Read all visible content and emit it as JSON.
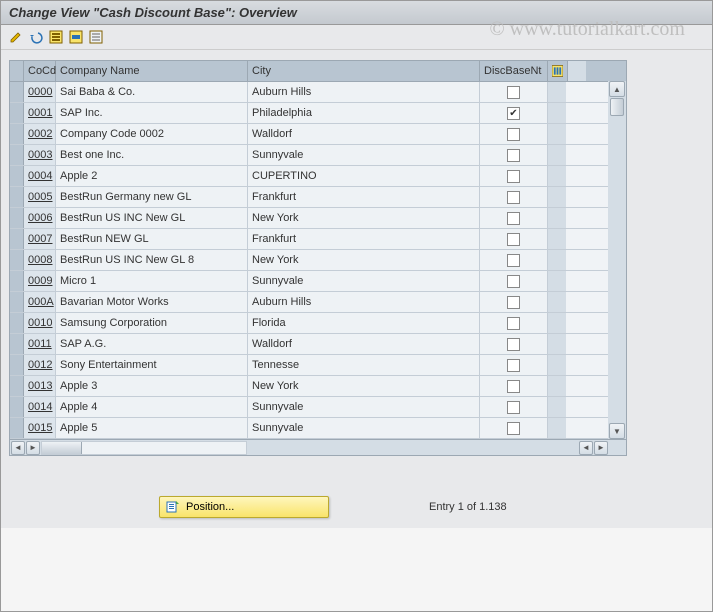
{
  "title": "Change View \"Cash Discount Base\": Overview",
  "watermark": "© www.tutorialkart.com",
  "toolbar": {
    "icons": [
      "edit-icon",
      "undo-icon",
      "select-all-icon",
      "select-block-icon",
      "deselect-icon"
    ]
  },
  "table": {
    "headers": {
      "cocd": "CoCd",
      "name": "Company Name",
      "city": "City",
      "disc": "DiscBaseNt"
    },
    "rows": [
      {
        "cocd": "0000",
        "name": "Sai Baba & Co.",
        "city": "Auburn Hills",
        "disc": false
      },
      {
        "cocd": "0001",
        "name": "SAP Inc.",
        "city": "Philadelphia",
        "disc": true
      },
      {
        "cocd": "0002",
        "name": "Company Code 0002",
        "city": "Walldorf",
        "disc": false
      },
      {
        "cocd": "0003",
        "name": "Best one Inc.",
        "city": "Sunnyvale",
        "disc": false
      },
      {
        "cocd": "0004",
        "name": "Apple 2",
        "city": "CUPERTINO",
        "disc": false
      },
      {
        "cocd": "0005",
        "name": "BestRun Germany new GL",
        "city": "Frankfurt",
        "disc": false
      },
      {
        "cocd": "0006",
        "name": "BestRun US INC New GL",
        "city": "New York",
        "disc": false
      },
      {
        "cocd": "0007",
        "name": "BestRun NEW GL",
        "city": "Frankfurt",
        "disc": false
      },
      {
        "cocd": "0008",
        "name": "BestRun US INC New GL 8",
        "city": "New York",
        "disc": false
      },
      {
        "cocd": "0009",
        "name": "Micro 1",
        "city": "Sunnyvale",
        "disc": false
      },
      {
        "cocd": "000A",
        "name": "Bavarian Motor Works",
        "city": "Auburn Hills",
        "disc": false
      },
      {
        "cocd": "0010",
        "name": "Samsung Corporation",
        "city": "Florida",
        "disc": false
      },
      {
        "cocd": "0011",
        "name": "SAP A.G.",
        "city": "Walldorf",
        "disc": false
      },
      {
        "cocd": "0012",
        "name": "Sony Entertainment",
        "city": "Tennesse",
        "disc": false
      },
      {
        "cocd": "0013",
        "name": "Apple 3",
        "city": "New York",
        "disc": false
      },
      {
        "cocd": "0014",
        "name": "Apple 4",
        "city": "Sunnyvale",
        "disc": false
      },
      {
        "cocd": "0015",
        "name": "Apple 5",
        "city": "Sunnyvale",
        "disc": false
      }
    ]
  },
  "footer": {
    "position_label": "Position...",
    "entry_text": "Entry 1 of 1.138"
  }
}
